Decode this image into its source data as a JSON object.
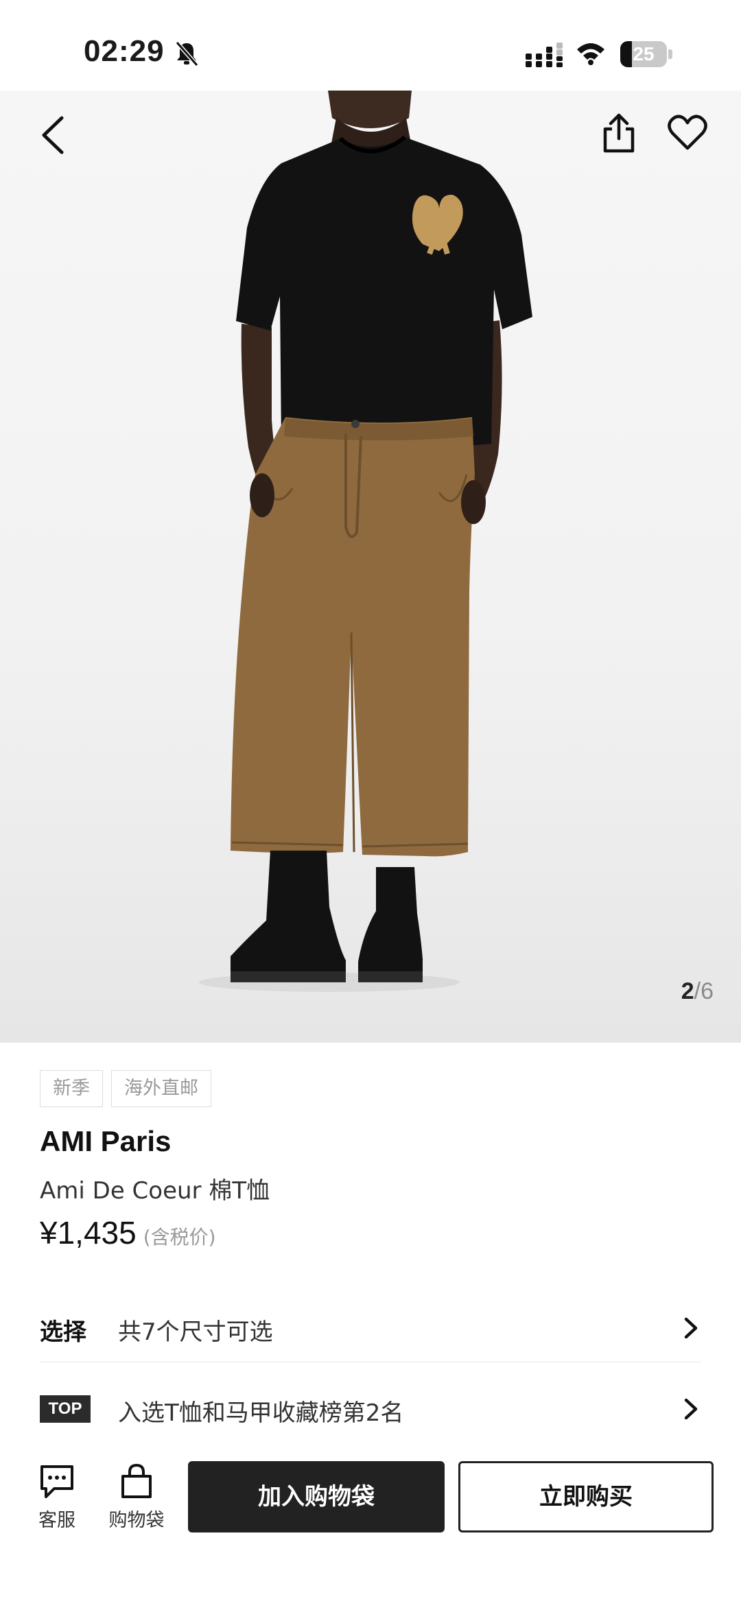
{
  "status_bar": {
    "time": "02:29",
    "battery": "25",
    "battery_level": 0.25
  },
  "gallery": {
    "current": "2",
    "separator": "/",
    "total": "6"
  },
  "product": {
    "tags": [
      "新季",
      "海外直邮"
    ],
    "brand": "AMI Paris",
    "name": "Ami De Coeur 棉T恤",
    "price": "¥1,435",
    "tax_note": "(含税价)"
  },
  "options": {
    "select_label": "选择",
    "select_text": "共7个尺寸可选",
    "top_badge": "TOP",
    "ranking_text": "入选T恤和马甲收藏榜第2名"
  },
  "bottom_bar": {
    "service_label": "客服",
    "bag_label": "购物袋",
    "add_to_bag": "加入购物袋",
    "buy_now": "立即购买"
  },
  "colors": {
    "primary_dark": "#222222",
    "shirt": "#121212",
    "pants": "#8e6a3e",
    "logo": "#c29a5c"
  },
  "icons": [
    "bell-off-icon",
    "signal-icon",
    "wifi-icon",
    "battery-icon",
    "back-icon",
    "share-icon",
    "heart-icon",
    "chevron-right-icon",
    "chat-icon",
    "shopping-bag-icon"
  ]
}
